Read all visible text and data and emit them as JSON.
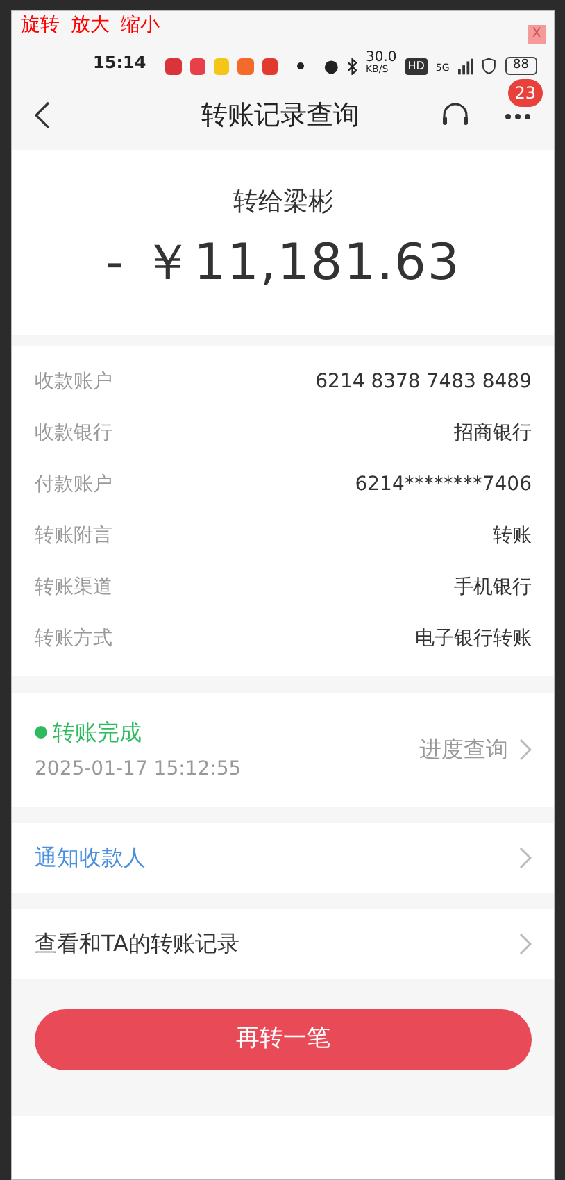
{
  "overlay_tools": [
    "旋转",
    "放大",
    "缩小"
  ],
  "overlay_close": "X",
  "status_bar": {
    "time": "15:14",
    "speed": "30.0",
    "speed_unit": "KB/S",
    "hd": "HD",
    "network": "5G",
    "battery": "88",
    "app_icons": [
      {
        "color": "#d8343a"
      },
      {
        "color": "#e8404a"
      },
      {
        "color": "#f5c518"
      },
      {
        "color": "#f36a2b"
      },
      {
        "color": "#e23a2e"
      }
    ]
  },
  "header": {
    "title": "转账记录查询",
    "badge": "23"
  },
  "summary": {
    "recipient": "转给梁彬",
    "amount": "- ￥11,181.63"
  },
  "details": [
    {
      "label": "收款账户",
      "value": "6214 8378 7483 8489"
    },
    {
      "label": "收款银行",
      "value": "招商银行"
    },
    {
      "label": "付款账户",
      "value": "6214********7406"
    },
    {
      "label": "转账附言",
      "value": "转账"
    },
    {
      "label": "转账渠道",
      "value": "手机银行"
    },
    {
      "label": "转账方式",
      "value": "电子银行转账"
    }
  ],
  "status": {
    "text": "转账完成",
    "color": "#2dbb5e",
    "time": "2025-01-17 15:12:55",
    "action": "进度查询"
  },
  "links": [
    {
      "text": "通知收款人",
      "kind": "accent"
    },
    {
      "text": "查看和TA的转账记录",
      "kind": "plain"
    }
  ],
  "primary_button": "再转一笔"
}
